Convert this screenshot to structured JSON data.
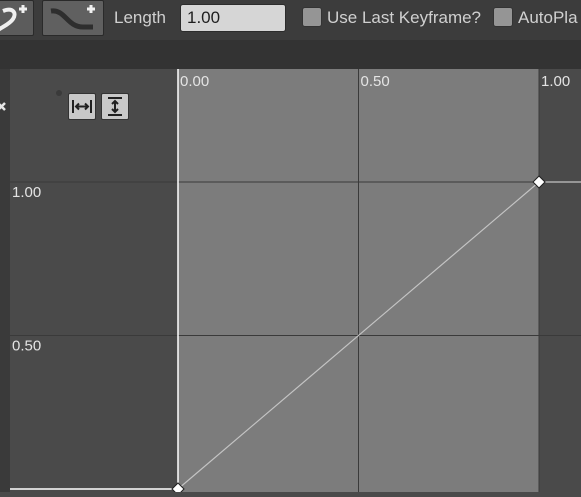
{
  "toolbar": {
    "add_key_icon": "add-key-icon",
    "add_curve_icon": "add-curve-icon",
    "length_label": "Length",
    "length_value": "1.00",
    "use_last_keyframe_label": "Use Last Keyframe?",
    "use_last_keyframe_checked": false,
    "autoplay_label": "AutoPla",
    "autoplay_checked": false
  },
  "graph": {
    "zoom_buttons": [
      {
        "icon": "fit-horizontal-icon"
      },
      {
        "icon": "fit-vertical-icon"
      }
    ],
    "time_ticks": [
      "0.00",
      "0.50",
      "1.00"
    ],
    "value_ticks": [
      "1.00",
      "0.50"
    ],
    "curve": {
      "type": "linear",
      "keys": [
        {
          "time": 0.0,
          "value": 0.0
        },
        {
          "time": 1.0,
          "value": 1.0
        }
      ]
    },
    "colors": {
      "outside_range": "#4a4a4a",
      "inside_range": "#7c7c7c",
      "gridline": "#3a3a3a",
      "curve": "#c4c4c4",
      "zero_time_line": "#ffffff",
      "key": "#ffffff"
    }
  }
}
